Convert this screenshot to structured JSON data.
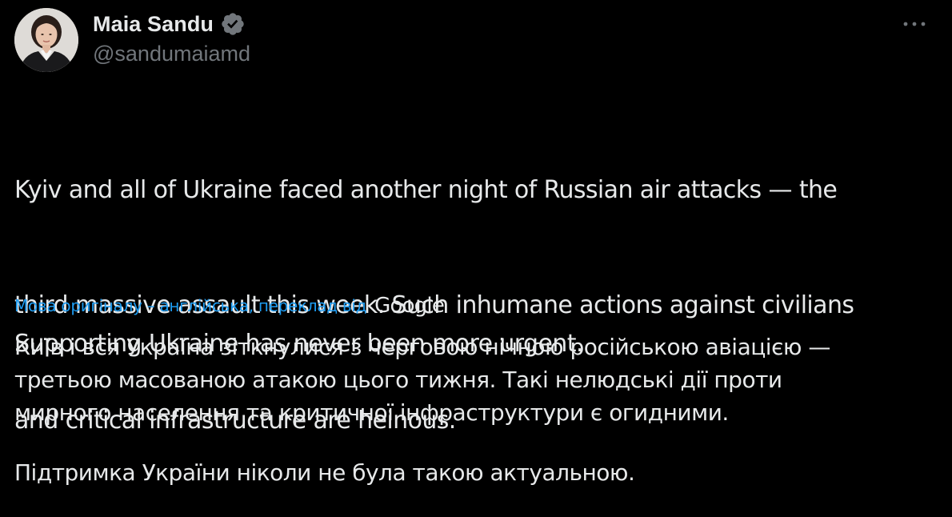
{
  "author": {
    "display_name": "Maia Sandu",
    "handle": "@sandumaiamd",
    "verified": true,
    "verified_color": "#71767b"
  },
  "menu": {
    "icon": "more-horizontal-icon"
  },
  "original": {
    "paragraph1_lines": [
      "Kyiv and all of Ukraine faced another night of Russian air attacks — the",
      "third massive assault this week. Such inhumane actions against civilians",
      "and critical infrastructure are heinous."
    ],
    "paragraph2_lines": [
      "Supporting Ukraine has never been more urgent."
    ]
  },
  "translation": {
    "notice": "Мова оригіналу – англійська, переклад від",
    "provider": "Google",
    "link_color": "#1d9bf0",
    "paragraph1_lines": [
      "Київ і вся Україна зіткнулися з черговою нічною російською авіацією —",
      "третьою масованою атакою цього тижня. Такі нелюдські дії проти",
      "мирного населення та критичної інфраструктури є огидними."
    ],
    "paragraph2_lines": [
      "Підтримка України ніколи не була такою актуальною."
    ]
  }
}
